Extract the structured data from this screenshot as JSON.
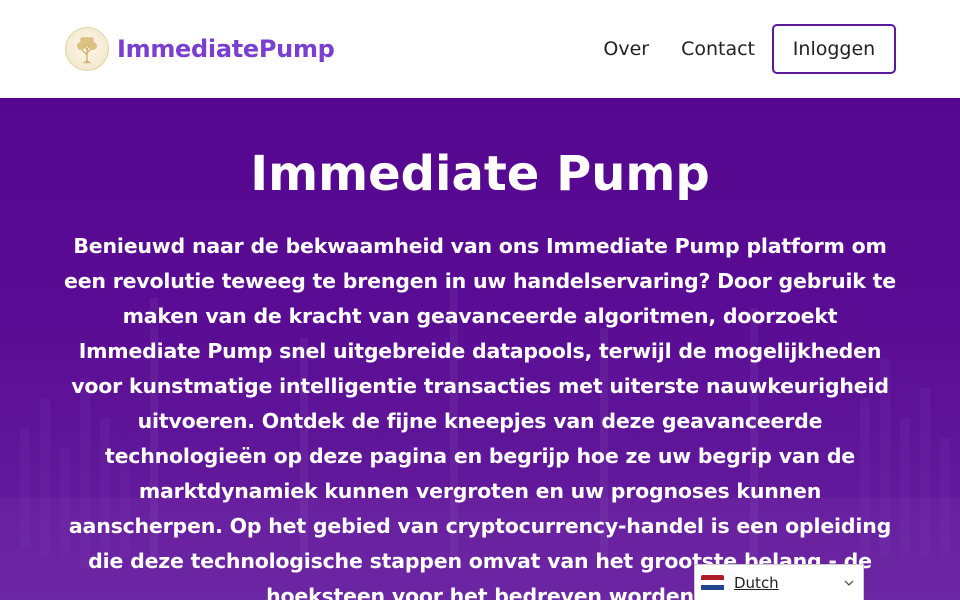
{
  "header": {
    "brand": "ImmediatePump",
    "nav": {
      "about": "Over",
      "contact": "Contact",
      "login": "Inloggen"
    }
  },
  "hero": {
    "title": "Immediate Pump",
    "paragraph": "Benieuwd naar de bekwaamheid van ons Immediate Pump platform om een revolutie teweeg te brengen in uw handelservaring? Door gebruik te maken van de kracht van geavanceerde algoritmen, doorzoekt Immediate Pump snel uitgebreide datapools, terwijl de mogelijkheden voor kunstmatige intelligentie transacties met uiterste nauwkeurigheid uitvoeren. Ontdek de fijne kneepjes van deze geavanceerde technologieën op deze pagina en begrijp hoe ze uw begrip van de marktdynamiek kunnen vergroten en uw prognoses kunnen aanscherpen. Op het gebied van cryptocurrency-handel is een opleiding die deze technologische stappen omvat van het grootste belang - de hoeksteen voor het bedreven worden"
  },
  "language": {
    "selected": "Dutch",
    "flag_colors": [
      "#ae1c28",
      "#ffffff",
      "#21468b"
    ]
  },
  "icons": {
    "logo": "tree-logo-icon",
    "dropdown": "chevron-down-icon",
    "flag": "netherlands-flag-icon"
  },
  "colors": {
    "brand": "#7a3fd0",
    "hero_bg": "#55078f",
    "login_border": "#5b1a9c"
  }
}
